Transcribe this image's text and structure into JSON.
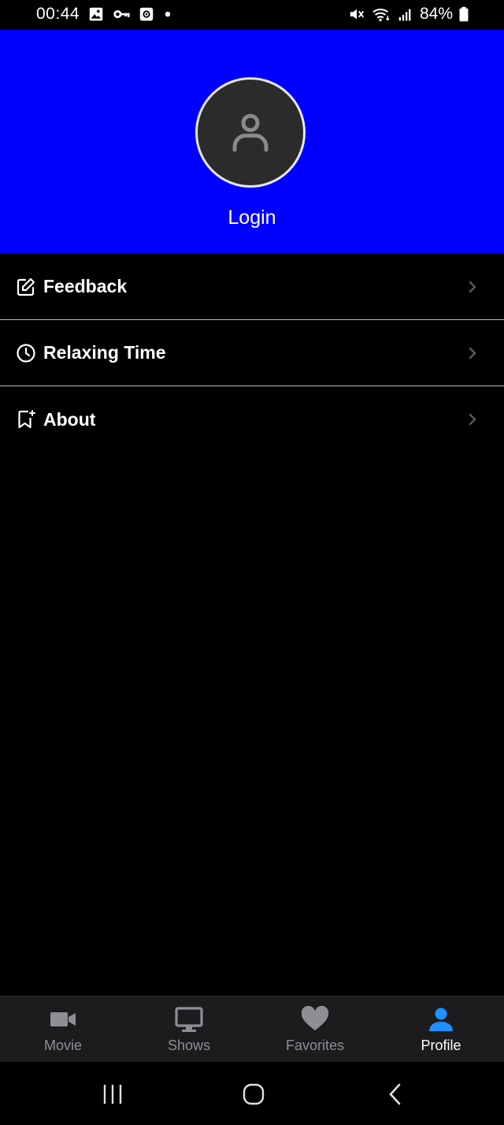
{
  "status_bar": {
    "time": "00:44",
    "battery": "84%",
    "left_icons": [
      "image-icon",
      "key-icon",
      "screen-record-icon",
      "dot-icon"
    ],
    "right_icons": [
      "mute-icon",
      "wifi-icon",
      "signal-icon",
      "battery-icon"
    ]
  },
  "header": {
    "background_color": "#0000ff",
    "avatar_icon": "person-icon",
    "login_label": "Login"
  },
  "menu": {
    "items": [
      {
        "label": "Feedback",
        "icon": "edit-icon"
      },
      {
        "label": "Relaxing Time",
        "icon": "clock-icon"
      },
      {
        "label": "About",
        "icon": "bookmark-sparkle-icon"
      }
    ]
  },
  "bottom_nav": {
    "active_color": "#1e90ff",
    "inactive_color": "#8e8e93",
    "tabs": [
      {
        "label": "Movie",
        "icon": "video-camera-icon",
        "active": false
      },
      {
        "label": "Shows",
        "icon": "tv-icon",
        "active": false
      },
      {
        "label": "Favorites",
        "icon": "heart-icon",
        "active": false
      },
      {
        "label": "Profile",
        "icon": "person-icon",
        "active": true
      }
    ]
  },
  "system_nav": {
    "buttons": [
      "recents-icon",
      "home-icon",
      "back-icon"
    ]
  }
}
